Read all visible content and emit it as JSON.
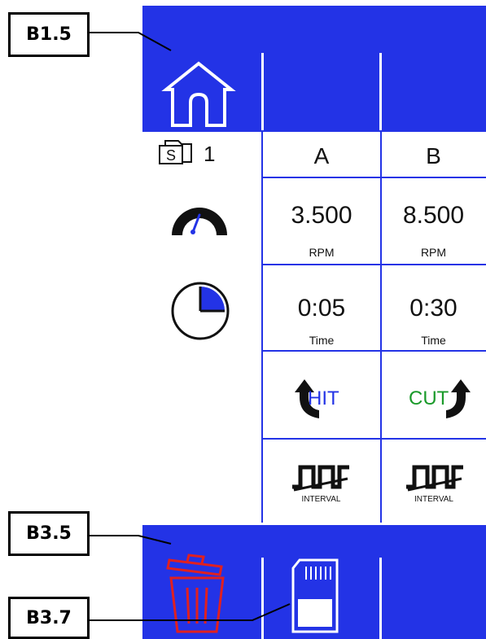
{
  "callouts": {
    "top": "B1.5",
    "bottom_left": "B3.5",
    "bottom_sd": "B3.7"
  },
  "header_row": {
    "program_number": "1",
    "folder_letter": "S",
    "col_a": "A",
    "col_b": "B"
  },
  "speed_row": {
    "a_value": "3.500",
    "a_unit": "RPM",
    "b_value": "8.500",
    "b_unit": "RPM"
  },
  "time_row": {
    "a_value": "0:05",
    "a_unit": "Time",
    "b_value": "0:30",
    "b_unit": "Time"
  },
  "direction_row": {
    "a_label": "HIT",
    "a_color": "#2333e6",
    "b_label": "CUT",
    "b_color": "#1a9a2a"
  },
  "interval_row": {
    "a_label": "INTERVAL",
    "b_label": "INTERVAL"
  },
  "colors": {
    "panel_blue": "#2333e6",
    "trash_red": "#e02020"
  },
  "icons": [
    "home-icon",
    "folder-icon",
    "speedometer-icon",
    "clock-icon",
    "rotate-left-icon",
    "rotate-right-icon",
    "interval-wave-icon",
    "trash-icon",
    "sd-card-icon"
  ]
}
